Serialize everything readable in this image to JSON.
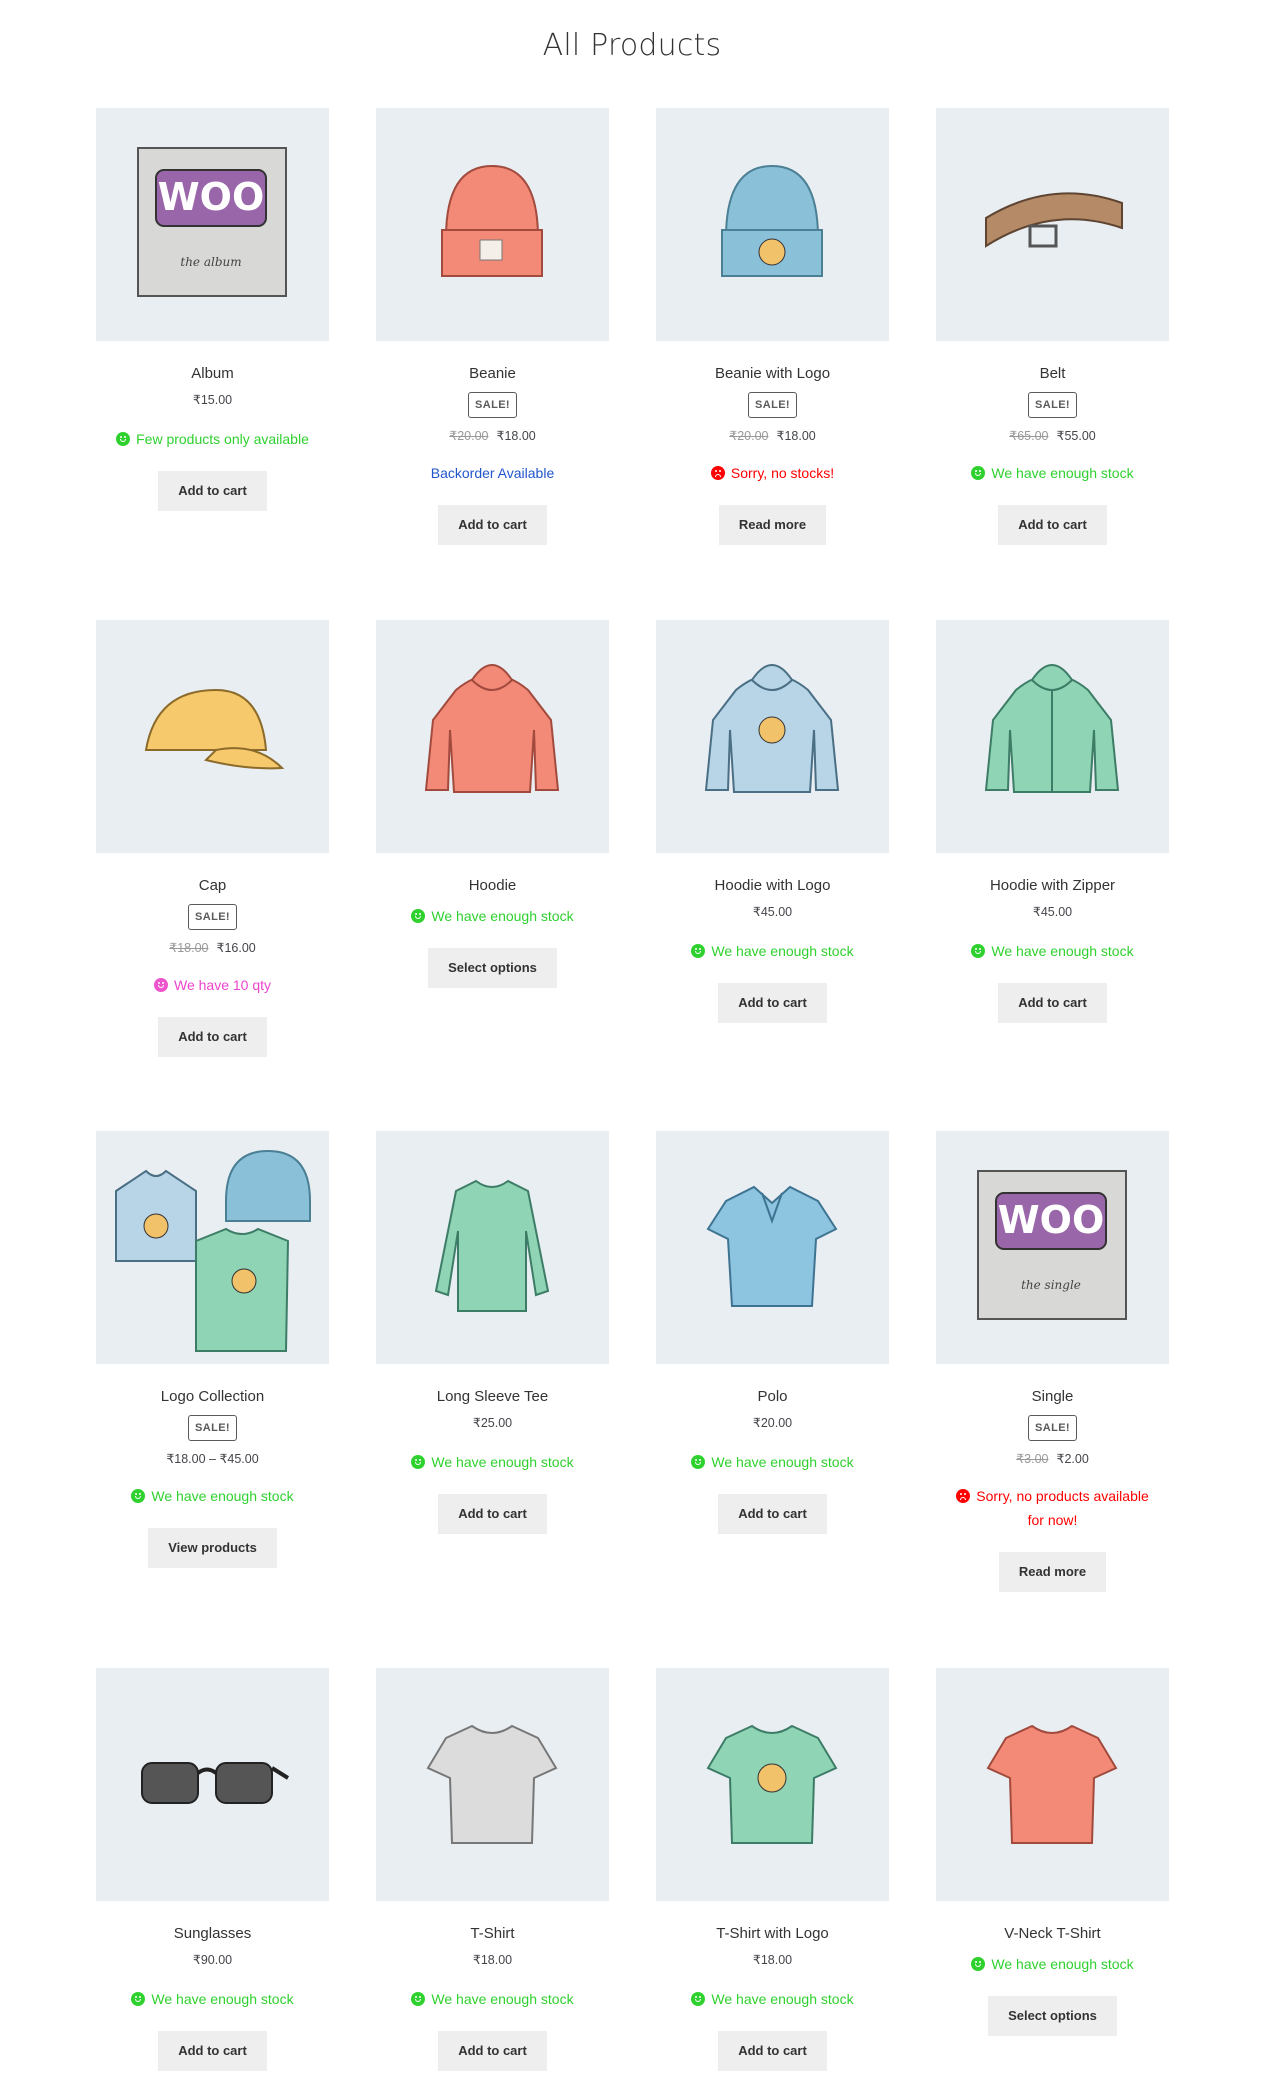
{
  "page": {
    "title": "All Products"
  },
  "products": [
    {
      "name": "Album",
      "sale": "",
      "old_price": "",
      "price": "₹15.00",
      "stock": "Few products only available",
      "stock_type": "green",
      "button": "Add to cart",
      "image": "album-icon"
    },
    {
      "name": "Beanie",
      "sale": "SALE!",
      "old_price": "₹20.00",
      "price": "₹18.00",
      "stock": "Backorder Available",
      "stock_type": "blue",
      "button": "Add to cart",
      "image": "beanie-icon"
    },
    {
      "name": "Beanie with Logo",
      "sale": "SALE!",
      "old_price": "₹20.00",
      "price": "₹18.00",
      "stock": "Sorry, no stocks!",
      "stock_type": "red",
      "button": "Read more",
      "image": "beanie-logo-icon"
    },
    {
      "name": "Belt",
      "sale": "SALE!",
      "old_price": "₹65.00",
      "price": "₹55.00",
      "stock": "We have enough stock",
      "stock_type": "green",
      "button": "Add to cart",
      "image": "belt-icon"
    },
    {
      "name": "Cap",
      "sale": "SALE!",
      "old_price": "₹18.00",
      "price": "₹16.00",
      "stock": "We have 10 qty",
      "stock_type": "pink",
      "button": "Add to cart",
      "image": "cap-icon"
    },
    {
      "name": "Hoodie",
      "sale": "",
      "old_price": "",
      "price": "",
      "stock": "We have enough stock",
      "stock_type": "green",
      "button": "Select options",
      "image": "hoodie-icon"
    },
    {
      "name": "Hoodie with Logo",
      "sale": "",
      "old_price": "",
      "price": "₹45.00",
      "stock": "We have enough stock",
      "stock_type": "green",
      "button": "Add to cart",
      "image": "hoodie-logo-icon"
    },
    {
      "name": "Hoodie with Zipper",
      "sale": "",
      "old_price": "",
      "price": "₹45.00",
      "stock": "We have enough stock",
      "stock_type": "green",
      "button": "Add to cart",
      "image": "hoodie-zipper-icon"
    },
    {
      "name": "Logo Collection",
      "sale": "SALE!",
      "old_price": "",
      "price": "₹18.00 – ₹45.00",
      "stock": "We have enough stock",
      "stock_type": "green",
      "button": "View products",
      "image": "logo-collection-icon"
    },
    {
      "name": "Long Sleeve Tee",
      "sale": "",
      "old_price": "",
      "price": "₹25.00",
      "stock": "We have enough stock",
      "stock_type": "green",
      "button": "Add to cart",
      "image": "long-sleeve-tee-icon"
    },
    {
      "name": "Polo",
      "sale": "",
      "old_price": "",
      "price": "₹20.00",
      "stock": "We have enough stock",
      "stock_type": "green",
      "button": "Add to cart",
      "image": "polo-icon"
    },
    {
      "name": "Single",
      "sale": "SALE!",
      "old_price": "₹3.00",
      "price": "₹2.00",
      "stock": "Sorry, no products available for now!",
      "stock_type": "red",
      "button": "Read more",
      "image": "single-icon"
    },
    {
      "name": "Sunglasses",
      "sale": "",
      "old_price": "",
      "price": "₹90.00",
      "stock": "We have enough stock",
      "stock_type": "green",
      "button": "Add to cart",
      "image": "sunglasses-icon"
    },
    {
      "name": "T-Shirt",
      "sale": "",
      "old_price": "",
      "price": "₹18.00",
      "stock": "We have enough stock",
      "stock_type": "green",
      "button": "Add to cart",
      "image": "tshirt-icon"
    },
    {
      "name": "T-Shirt with Logo",
      "sale": "",
      "old_price": "",
      "price": "₹18.00",
      "stock": "We have enough stock",
      "stock_type": "green",
      "button": "Add to cart",
      "image": "tshirt-logo-icon"
    },
    {
      "name": "V-Neck T-Shirt",
      "sale": "",
      "old_price": "",
      "price": "",
      "stock": "We have enough stock",
      "stock_type": "green",
      "button": "Select options",
      "image": "vneck-tshirt-icon"
    }
  ],
  "image_text": {
    "woo": "WOO",
    "album_sub": "the album",
    "single_sub": "the single"
  },
  "colors": {
    "stock_green": "#2fd12f",
    "stock_red": "#ff0000",
    "stock_pink": "#ee44cc",
    "stock_blue": "#2255cc",
    "thumb_bg": "#e9eef2"
  }
}
